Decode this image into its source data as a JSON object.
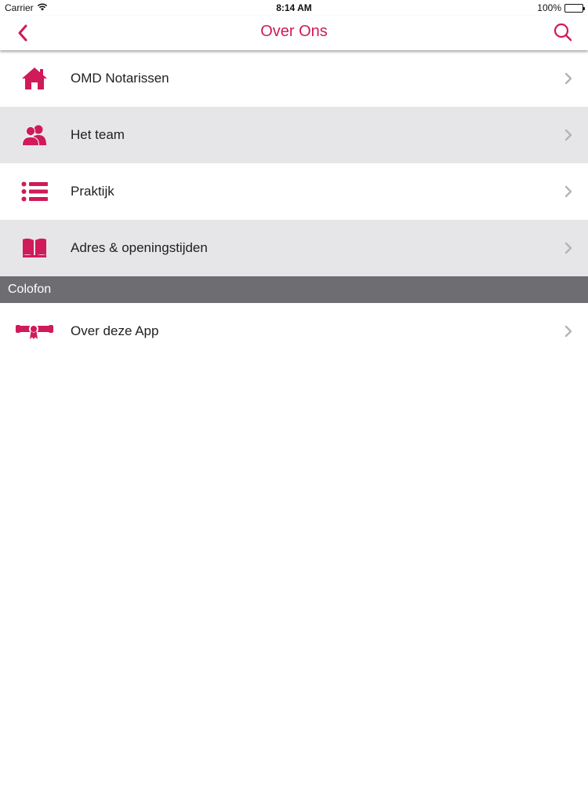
{
  "status_bar": {
    "carrier": "Carrier",
    "time": "8:14 AM",
    "battery": "100%"
  },
  "nav": {
    "title": "Over Ons"
  },
  "colors": {
    "accent": "#d01a5a",
    "row_grey": "#e6e5e8",
    "section_header_bg": "#6e6d71",
    "chevron": "#b4b4b8"
  },
  "menu_items": [
    {
      "label": "OMD Notarissen",
      "icon": "home-icon"
    },
    {
      "label": "Het team",
      "icon": "team-icon"
    },
    {
      "label": "Praktijk",
      "icon": "list-icon"
    },
    {
      "label": "Adres & openingstijden",
      "icon": "book-icon"
    }
  ],
  "section": {
    "title": "Colofon"
  },
  "colofon_items": [
    {
      "label": "Over deze App",
      "icon": "diploma-icon"
    }
  ]
}
